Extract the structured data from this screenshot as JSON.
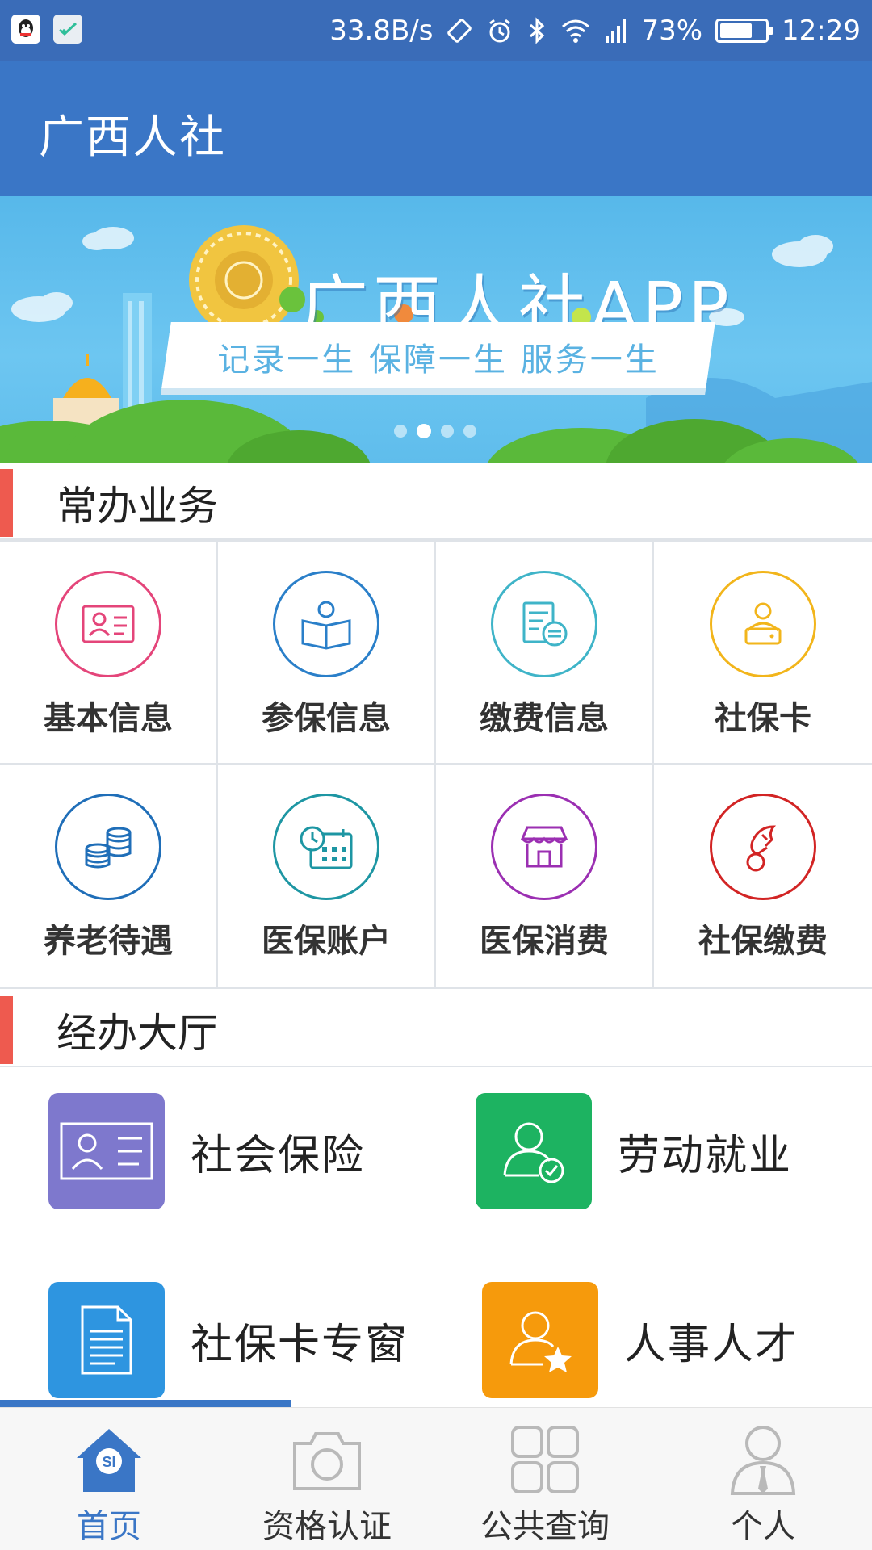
{
  "status_bar": {
    "speed": "33.8B/s",
    "battery_pct": "73%",
    "battery_level": 0.73,
    "time": "12:29",
    "color": "#3a6cb8"
  },
  "app_bar": {
    "title": "广西人社",
    "color": "#3a76c6"
  },
  "banner": {
    "title": "广西人社APP",
    "slogan": "记录一生  保障一生 服务一生",
    "slide_count": 4,
    "active_slide": 2
  },
  "common": {
    "title": "常办业务",
    "items": [
      {
        "label": "基本信息",
        "icon": "id-card-icon",
        "color": "#e4457a"
      },
      {
        "label": "参保信息",
        "icon": "book-reader-icon",
        "color": "#2a7fc9"
      },
      {
        "label": "缴费信息",
        "icon": "payment-document-icon",
        "color": "#3fb4c8"
      },
      {
        "label": "社保卡",
        "icon": "card-reader-icon",
        "color": "#f2b51b"
      },
      {
        "label": "养老待遇",
        "icon": "coins-stack-icon",
        "color": "#1f6eb8"
      },
      {
        "label": "医保账户",
        "icon": "clock-calendar-icon",
        "color": "#1d96a3"
      },
      {
        "label": "医保消费",
        "icon": "store-icon",
        "color": "#9b2fb2"
      },
      {
        "label": "社保缴费",
        "icon": "hand-coin-icon",
        "color": "#d22424"
      }
    ]
  },
  "hall": {
    "title": "经办大厅",
    "items": [
      {
        "label": "社会保险",
        "icon": "id-card-icon",
        "color": "#7e78cd"
      },
      {
        "label": "劳动就业",
        "icon": "user-check-icon",
        "color": "#1db361"
      },
      {
        "label": "社保卡专窗",
        "icon": "document-icon",
        "color": "#2e95e0"
      },
      {
        "label": "人事人才",
        "icon": "user-star-icon",
        "color": "#f69a0c"
      }
    ]
  },
  "bottom_nav": {
    "items": [
      {
        "label": "首页",
        "icon": "home-icon"
      },
      {
        "label": "资格认证",
        "icon": "camera-icon"
      },
      {
        "label": "公共查询",
        "icon": "grid-icon"
      },
      {
        "label": "个人",
        "icon": "user-icon"
      }
    ],
    "active_index": 0,
    "active_color": "#3a76c6"
  }
}
